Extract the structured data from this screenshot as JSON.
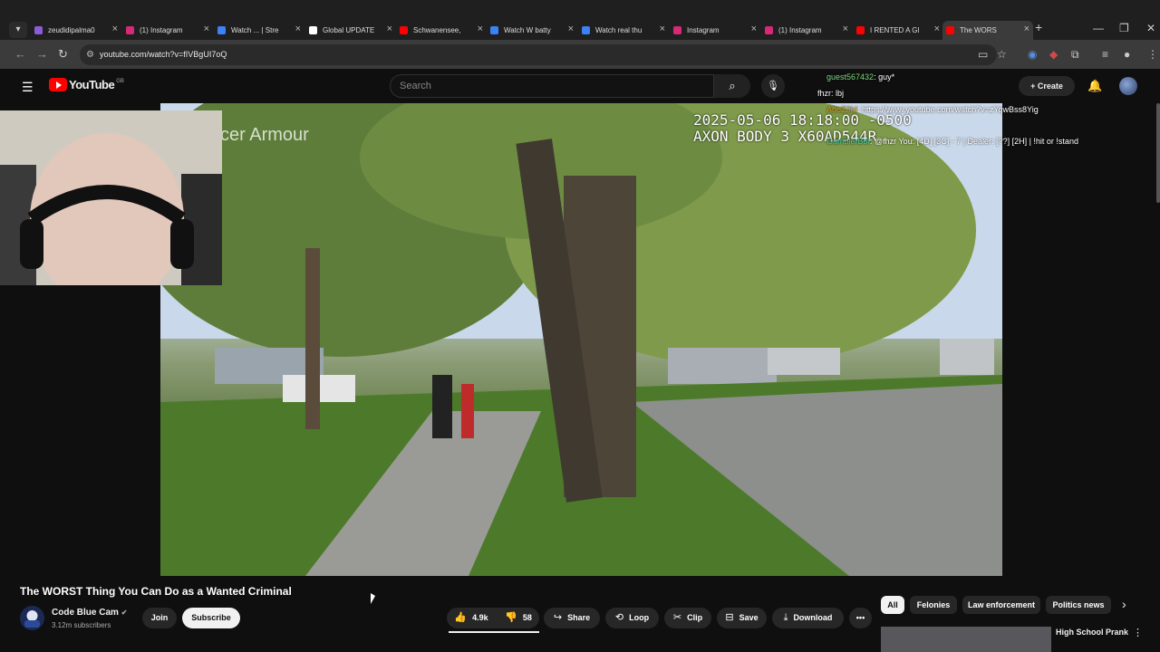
{
  "browser": {
    "tabs": [
      {
        "title": "zeudidipalma0",
        "color": "#8e5bd6"
      },
      {
        "title": "(1) Instagram",
        "color": "#d62976"
      },
      {
        "title": "Watch ... | Stre",
        "color": "#3b82f6"
      },
      {
        "title": "Global UPDATE",
        "color": "#ffffff"
      },
      {
        "title": "Schwanensee,",
        "color": "#ff0000"
      },
      {
        "title": "Watch W batty",
        "color": "#3b82f6"
      },
      {
        "title": "Watch real thu",
        "color": "#3b82f6"
      },
      {
        "title": "Instagram",
        "color": "#d62976"
      },
      {
        "title": "(1) Instagram",
        "color": "#d62976"
      },
      {
        "title": "I RENTED A GI",
        "color": "#ff0000"
      },
      {
        "title": "The WORS",
        "color": "#ff0000"
      }
    ],
    "url": "youtube.com/watch?v=fIVBgUI7oQ"
  },
  "youtube": {
    "logo_text": "YouTube",
    "region": "GB",
    "search_placeholder": "Search",
    "create_label": "Create"
  },
  "chat": [
    {
      "user": "guest567432",
      "message": ": guy*",
      "user_color": "#7fd87f"
    },
    {
      "user": "fhzr",
      "message": ": lbj",
      "user_color": "#ffffff"
    },
    {
      "user": "AboZ3bI",
      "message": ": https://www.youtube.com/watch?v=zYqwBss8Yig",
      "user_color": "#d4a017"
    },
    {
      "user": "GamblerBot",
      "message": ": @fhzr You: [4D] [3C] - 7 | Dealer: [??] [2H] | !hit or !stand",
      "user_color": "#3ecfa0"
    }
  ],
  "video": {
    "timestamp_line1": "2025-05-06 18:18:00 -0500",
    "timestamp_line2": "AXON BODY 3 X60AD544R",
    "watermark": "cer Armour"
  },
  "video_info": {
    "title": "The WORST Thing You Can Do as a Wanted Criminal",
    "channel_name": "Code Blue Cam",
    "subscribers": "3.12m subscribers",
    "join_label": "Join",
    "subscribe_label": "Subscribe",
    "likes": "4.9k",
    "dislikes": "58",
    "share_label": "Share",
    "loop_label": "Loop",
    "clip_label": "Clip",
    "save_label": "Save",
    "download_label": "Download"
  },
  "chips": [
    "All",
    "Felonies",
    "Law enforcement",
    "Politics news"
  ],
  "recommendation": {
    "title": "High School Prank"
  }
}
